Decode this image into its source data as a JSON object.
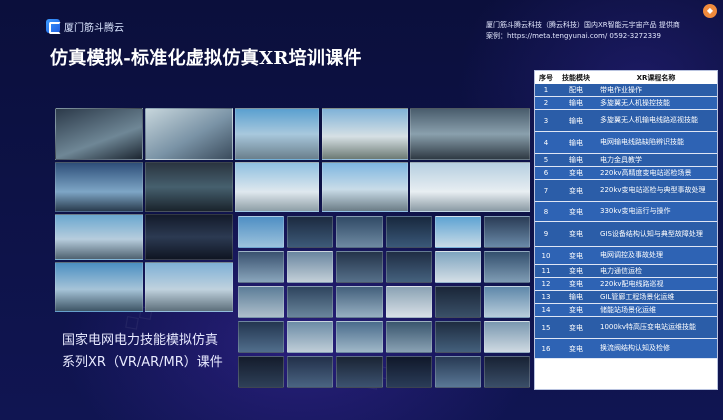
{
  "brand": {
    "logo_text": "厦门筋斗腾云"
  },
  "corporate": {
    "line1": "厦门筋斗腾云科技（腾云科技）国内XR智能元宇宙产品  提供商",
    "line2": "案例：https://meta.tengyunai.com/    0592-3272339"
  },
  "page": {
    "title": "仿真模拟-标准化虚拟仿真XR培训课件",
    "caption_line1": "国家电网电力技能模拟仿真",
    "caption_line2": "系列XR（VR/AR/MR）课件"
  },
  "table": {
    "headers": [
      "序号",
      "技能模块",
      "XR课程名称"
    ],
    "rows": [
      {
        "no": "1",
        "module": "配电",
        "course": "带电作业操作"
      },
      {
        "no": "2",
        "module": "输电",
        "course": "多旋翼无人机操控技能"
      },
      {
        "no": "3",
        "module": "输电",
        "course": "多旋翼无人机输电线路巡视技能"
      },
      {
        "no": "4",
        "module": "输电",
        "course": "电网输电线路缺陷辨识技能"
      },
      {
        "no": "5",
        "module": "输电",
        "course": "电力金具教学"
      },
      {
        "no": "6",
        "module": "变电",
        "course": "220kv高精度变电站巡检场景"
      },
      {
        "no": "7",
        "module": "变电",
        "course": "220kv变电站巡检与典型事故处理"
      },
      {
        "no": "8",
        "module": "变电",
        "course": "330kv变电运行与操作"
      },
      {
        "no": "9",
        "module": "变电",
        "course": "GIS设备结构认知与典型故障处理"
      },
      {
        "no": "10",
        "module": "变电",
        "course": "电网调控及事故处理"
      },
      {
        "no": "11",
        "module": "变电",
        "course": "电力通信运检"
      },
      {
        "no": "12",
        "module": "变电",
        "course": "220kv配电线路巡视"
      },
      {
        "no": "13",
        "module": "输电",
        "course": "GIL管廊工程场景化运维"
      },
      {
        "no": "14",
        "module": "变电",
        "course": "储能站场景化运维"
      },
      {
        "no": "15",
        "module": "变电",
        "course": "1000kv特高压变电站运维技能"
      },
      {
        "no": "16",
        "module": "变电",
        "course": "换流阀结构认知及检修"
      }
    ]
  },
  "colors": {
    "table_row": "#2b5da8",
    "background": "#0d1246",
    "accent": "#3c9cff"
  }
}
